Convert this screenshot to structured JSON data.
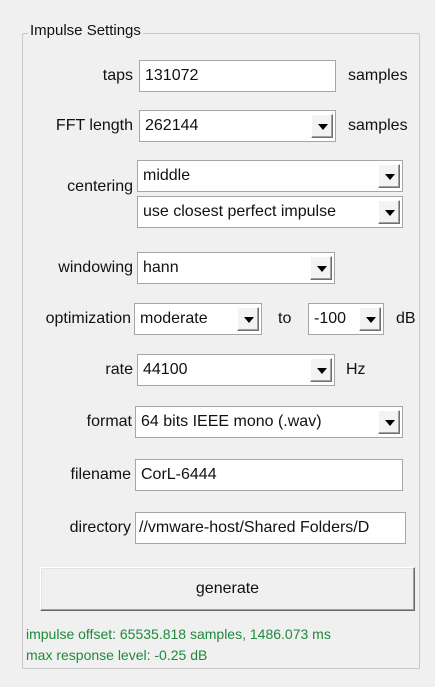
{
  "group": {
    "title": "Impulse Settings"
  },
  "taps": {
    "label": "taps",
    "value": "131072",
    "unit": "samples"
  },
  "fft": {
    "label": "FFT length",
    "value": "262144",
    "unit": "samples"
  },
  "centering": {
    "label": "centering",
    "value": "middle",
    "mode_value": "use closest perfect impulse"
  },
  "windowing": {
    "label": "windowing",
    "value": "hann"
  },
  "optimization": {
    "label": "optimization",
    "value": "moderate",
    "to_label": "to",
    "to_value": "-100",
    "unit": "dB"
  },
  "rate": {
    "label": "rate",
    "value": "44100",
    "unit": "Hz"
  },
  "format": {
    "label": "format",
    "value": "64 bits IEEE mono (.wav)"
  },
  "filename": {
    "label": "filename",
    "value": "CorL-6444"
  },
  "directory": {
    "label": "directory",
    "value": "//vmware-host/Shared Folders/D"
  },
  "actions": {
    "generate_label": "generate"
  },
  "status": {
    "offset": "impulse offset: 65535.818 samples, 1486.073 ms",
    "max_level": "max response level: -0.25 dB"
  },
  "icons": {
    "dropdown": "chevron-down-icon"
  },
  "colors": {
    "status_text": "#1f8a3a",
    "background": "#f0f0f0"
  }
}
